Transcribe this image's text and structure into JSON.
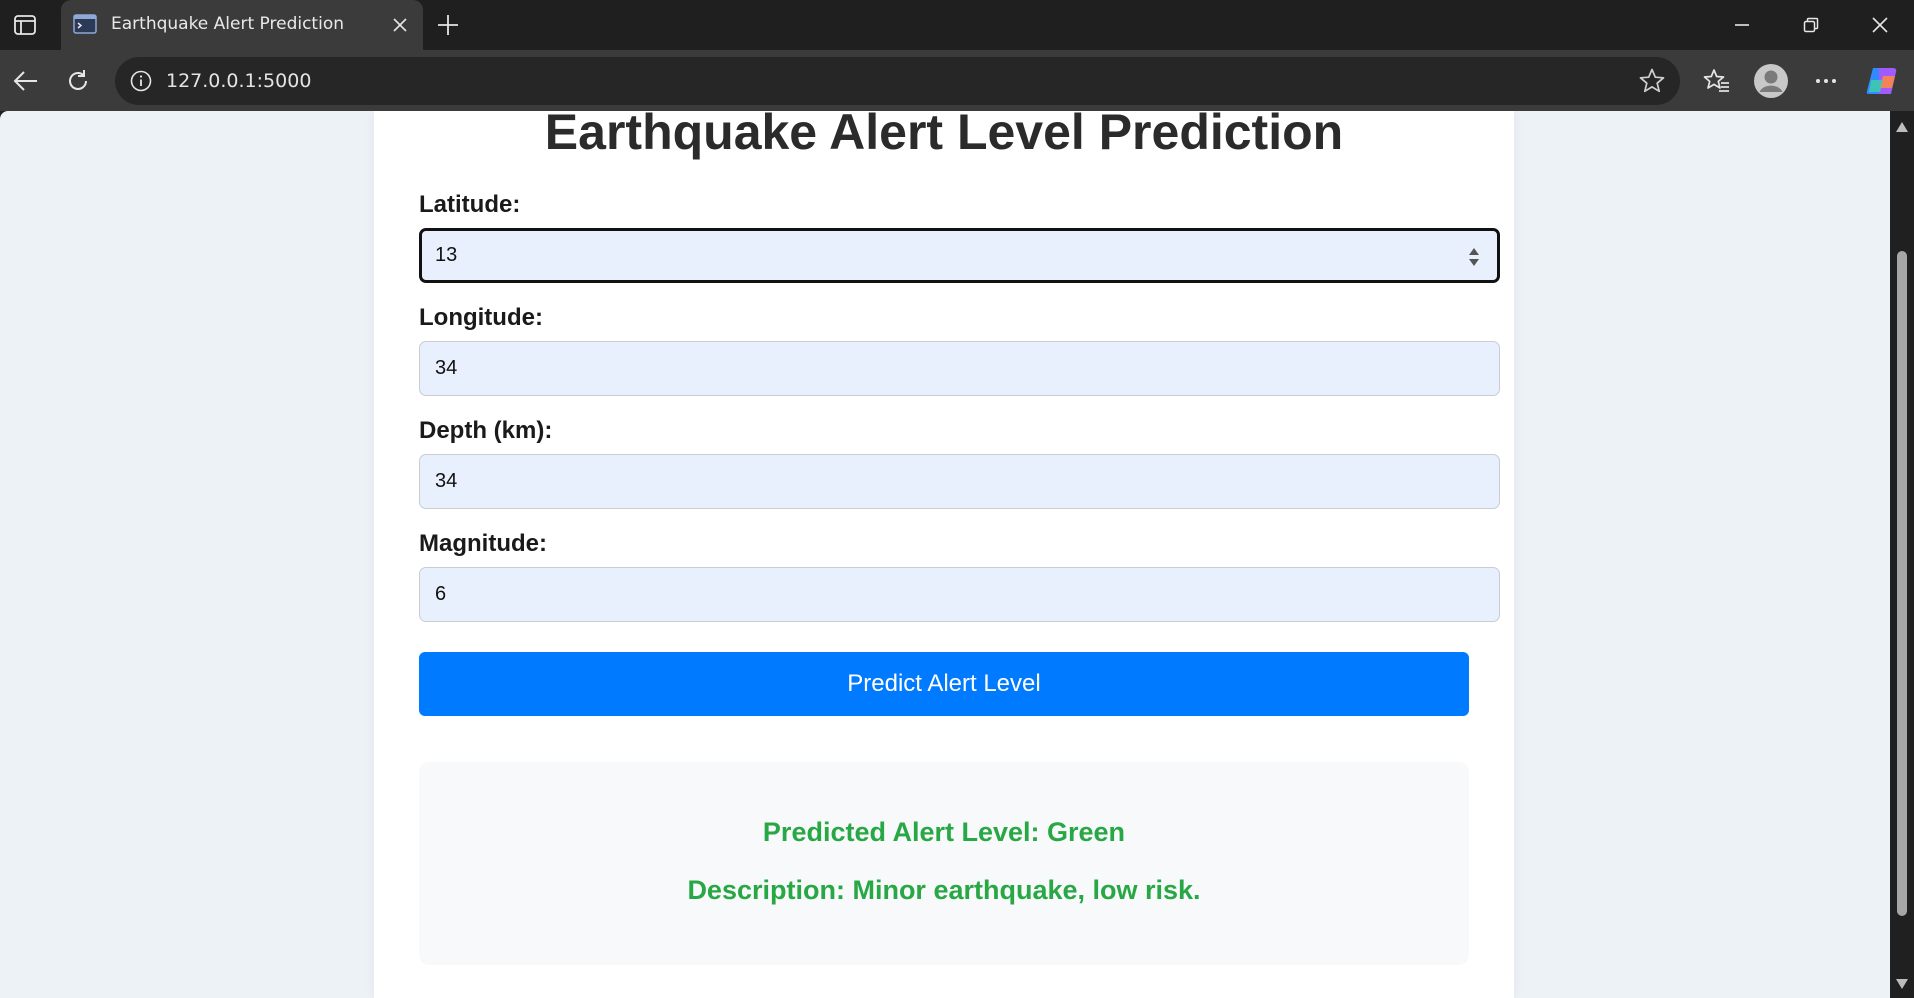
{
  "browser": {
    "tab_title": "Earthquake Alert Prediction",
    "url": "127.0.0.1:5000"
  },
  "page": {
    "title": "Earthquake Alert Level Prediction",
    "fields": [
      {
        "label": "Latitude:",
        "value": "13"
      },
      {
        "label": "Longitude:",
        "value": "34"
      },
      {
        "label": "Depth (km):",
        "value": "34"
      },
      {
        "label": "Magnitude:",
        "value": "6"
      }
    ],
    "submit_label": "Predict Alert Level",
    "result": {
      "alert_line": "Predicted Alert Level: Green",
      "description_line": "Description: Minor earthquake, low risk.",
      "color": "#28a745"
    }
  },
  "colors": {
    "button": "#007bff",
    "input_bg": "#e8f0fe",
    "page_bg": "#edf2f7"
  },
  "icons": [
    "sidebar-toggle-icon",
    "terminal-favicon-icon",
    "close-icon",
    "plus-icon",
    "minimize-icon",
    "restore-icon",
    "back-arrow-icon",
    "reload-icon",
    "info-icon",
    "star-icon",
    "favorites-icon",
    "profile-avatar-icon",
    "more-icon",
    "copilot-icon"
  ]
}
